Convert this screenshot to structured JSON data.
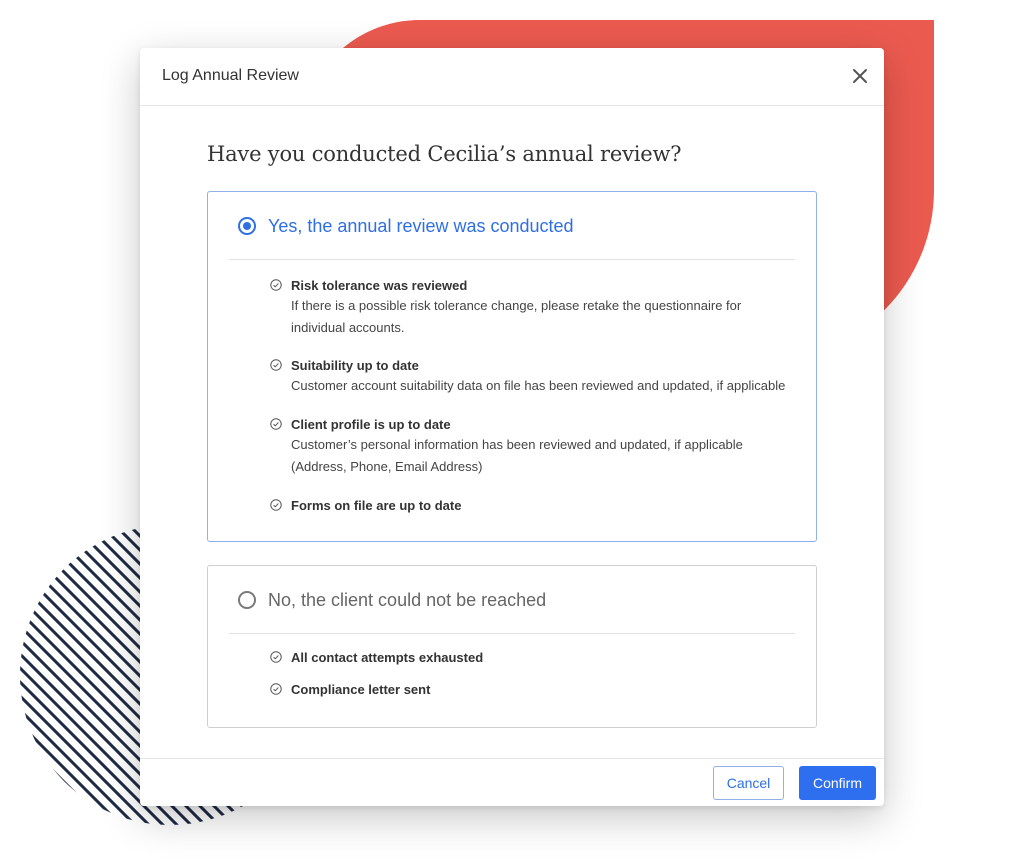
{
  "colors": {
    "accent": "#2f6fe4",
    "decor_red": "#eb5a4f",
    "decor_stripes": "#1f2a44"
  },
  "modal": {
    "title": "Log Annual Review",
    "close_icon": "close-icon",
    "question": "Have you conducted Cecilia’s annual review?"
  },
  "options": [
    {
      "label": "Yes, the annual review was conducted",
      "selected": true,
      "items": [
        {
          "title": "Risk tolerance was reviewed",
          "desc_lines": [
            "If there is a possible risk tolerance change, please retake the questionnaire for",
            "individual accounts."
          ]
        },
        {
          "title": "Suitability up to date",
          "desc_lines": [
            "Customer account suitability data on file has been reviewed and updated, if applicable"
          ]
        },
        {
          "title": "Client profile is up to date",
          "desc_lines": [
            "Customer’s personal information has been reviewed and updated, if applicable",
            "(Address, Phone, Email Address)"
          ]
        },
        {
          "title": "Forms on file are up to date",
          "desc_lines": []
        }
      ]
    },
    {
      "label": "No, the client could not be reached",
      "selected": false,
      "items": [
        {
          "title": "All contact attempts exhausted"
        },
        {
          "title": "Compliance letter sent"
        }
      ]
    }
  ],
  "footer": {
    "cancel_label": "Cancel",
    "confirm_label": "Confirm"
  }
}
